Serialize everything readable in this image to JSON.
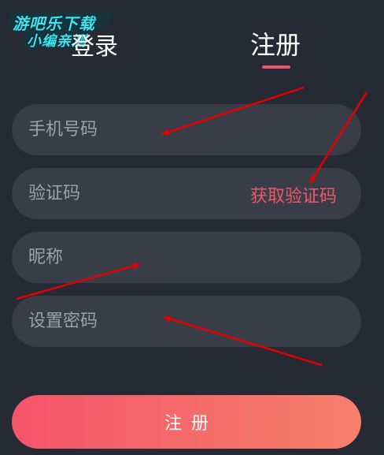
{
  "watermark": {
    "line1": "游吧乐下载",
    "line2": "小编亲测"
  },
  "tabs": {
    "login": "登录",
    "register": "注册"
  },
  "form": {
    "phone_placeholder": "手机号码",
    "code_placeholder": "验证码",
    "get_code_label": "获取验证码",
    "nickname_placeholder": "昵称",
    "password_placeholder": "设置密码"
  },
  "submit_label": "注册",
  "colors": {
    "background": "#262a35",
    "field": "#393d48",
    "accent": "#f0566a",
    "annotation_arrow": "#e60000"
  }
}
